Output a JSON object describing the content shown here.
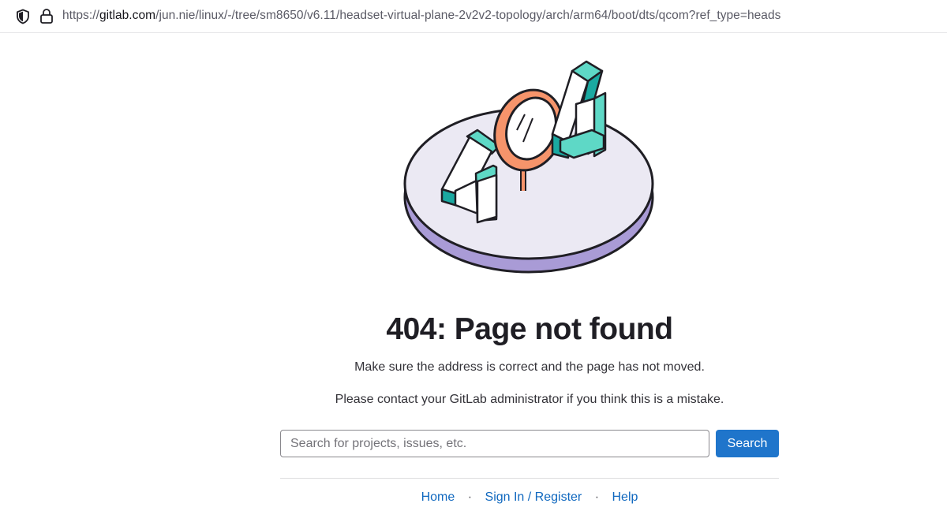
{
  "browser": {
    "url_prefix": "https://",
    "url_host": "gitlab.com",
    "url_path": "/jun.nie/linux/-/tree/sm8650/v6.11/headset-virtual-plane-2v2v2-topology/arch/arm64/boot/dts/qcom?ref_type=heads",
    "icons": [
      "shield-icon",
      "lock-icon"
    ]
  },
  "error": {
    "title": "404: Page not found",
    "message": "Make sure the address is correct and the page has not moved.",
    "contact": "Please contact your GitLab administrator if you think this is a mistake.",
    "illustration_icon": "404-illustration"
  },
  "search": {
    "placeholder": "Search for projects, issues, etc.",
    "value": "",
    "button_label": "Search"
  },
  "footer": {
    "home": "Home",
    "sign_in": "Sign In / Register",
    "help": "Help",
    "separator": "·"
  },
  "colors": {
    "primary_button": "#1f75cb",
    "link": "#1068bf",
    "teal": "#5ed8c6",
    "teal_dark": "#1aa9a1",
    "orange": "#f6946b",
    "platform_top": "#ebe9f3",
    "platform_side": "#a99bd6"
  }
}
